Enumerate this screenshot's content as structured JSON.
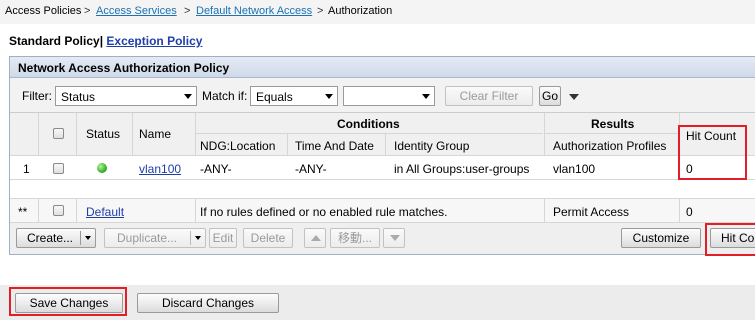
{
  "breadcrumb": {
    "items": [
      "Access Policies",
      "Access Services",
      "Default Network Access",
      "Authorization"
    ],
    "separator": ">"
  },
  "policy_tabs": {
    "standard": "Standard Policy",
    "divider": "|",
    "exception": "Exception Policy"
  },
  "panel": {
    "title": "Network Access Authorization Policy"
  },
  "filter": {
    "label": "Filter:",
    "field_value": "Status",
    "match_label": "Match if:",
    "operator_value": "Equals",
    "value_value": "",
    "clear_button": "Clear Filter",
    "go_button": "Go"
  },
  "table": {
    "group_headers": {
      "conditions": "Conditions",
      "results": "Results"
    },
    "headers": {
      "status": "Status",
      "name": "Name",
      "ndg_location": "NDG:Location",
      "time_and_date": "Time And Date",
      "identity_group": "Identity Group",
      "authorization_profiles": "Authorization Profiles",
      "hit_count": "Hit Count"
    },
    "rows": [
      {
        "index": "1",
        "status": "enabled",
        "name": "vlan100",
        "ndg_location": "-ANY-",
        "time_and_date": "-ANY-",
        "identity_group": "in All Groups:user-groups",
        "authorization_profiles": "vlan100",
        "hit_count": "0"
      }
    ],
    "default_row": {
      "index": "**",
      "name": "Default",
      "description": "If no rules defined or no enabled rule matches.",
      "result": "Permit Access",
      "hit_count": "0"
    }
  },
  "actions": {
    "create": "Create...",
    "duplicate": "Duplicate...",
    "edit": "Edit",
    "delete": "Delete",
    "move_to": "移動...",
    "customize": "Customize",
    "hit_count": "Hit Co"
  },
  "footer": {
    "save": "Save Changes",
    "discard": "Discard Changes"
  },
  "colors": {
    "highlight": "#e21f26",
    "link": "#1f3ea8",
    "status_enabled": "#38b52a"
  }
}
